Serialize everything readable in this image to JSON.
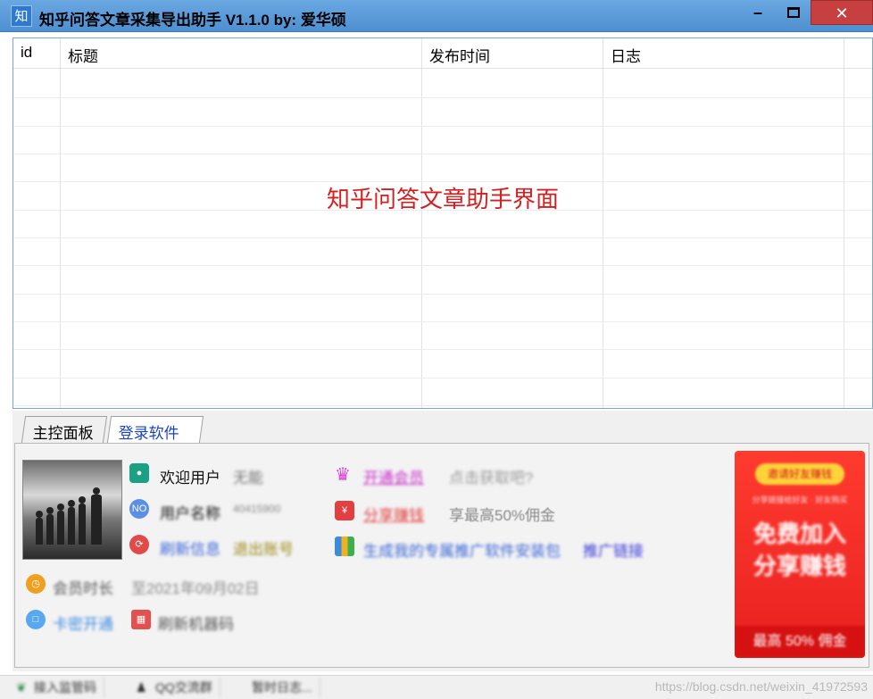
{
  "window": {
    "icon_glyph": "知",
    "title": "知乎问答文章采集导出助手 V1.1.0  by: 爱华硕",
    "min_glyph": "–",
    "close_glyph": "✕"
  },
  "grid": {
    "columns": [
      "id",
      "标题",
      "发布时间",
      "日志"
    ],
    "center_label": "知乎问答文章助手界面"
  },
  "tabs": [
    {
      "label": "主控面板"
    },
    {
      "label": "登录软件"
    }
  ],
  "login": {
    "welcome_label": "欢迎用户",
    "welcome_value": "无能",
    "account_label": "用户名称",
    "account_value": "40415900",
    "refresh_label": "刷新信息",
    "logout_label": "退出账号",
    "points_label": "会员时长",
    "points_value": "至2021年09月02日",
    "start_label": "卡密开通",
    "card_label": "刷新机器码",
    "vip_label": "开通会员",
    "vip_hint": "点击获取吧?",
    "share_label": "分享赚钱",
    "share_hint": "享最高50%佣金",
    "gen_label": "生成我的专属推广软件安装包",
    "gen_link": "推广链接"
  },
  "promo": {
    "pill": "邀请好友赚钱",
    "small": "分享链接给好友 · 好友购买",
    "big_line1": "免费加入",
    "big_line2": "分享赚钱",
    "foot": "最高 50% 佣金"
  },
  "statusbar": {
    "item1": "接入监管码",
    "item2": "QQ交流群",
    "item3": "暂时日志...",
    "watermark": "https://blog.csdn.net/weixin_41972593"
  }
}
